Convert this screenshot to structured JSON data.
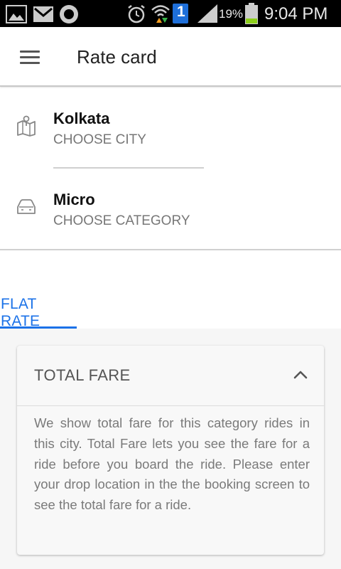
{
  "status_bar": {
    "battery_percent": "19%",
    "time": "9:04 PM",
    "sim_badge": "1",
    "icons": [
      "gallery-icon",
      "gmail-icon",
      "ola-icon",
      "alarm-icon",
      "wifi-data-icon",
      "sim-icon",
      "signal-icon",
      "battery-icon"
    ]
  },
  "app_bar": {
    "title": "Rate card",
    "menu_icon": "hamburger-icon"
  },
  "city": {
    "value": "Kolkata",
    "label": "CHOOSE CITY",
    "icon": "map-pin-icon"
  },
  "category": {
    "value": "Micro",
    "label": "CHOOSE CATEGORY",
    "icon": "car-icon"
  },
  "tabs": [
    {
      "label": "FLAT RATE",
      "selected": true
    }
  ],
  "fare_card": {
    "title": "TOTAL FARE",
    "expanded": true,
    "description": "We show total fare for this category rides in this city. Total Fare lets you see the fare for a ride before you board the ride. Please enter your drop location in the the booking screen to see the total fare for a ride."
  },
  "colors": {
    "accent": "#1b72e8",
    "status_bar_bg": "#000000",
    "battery_fill": "#8ccf1a",
    "wifi_arrow_up": "#f29c1f"
  }
}
